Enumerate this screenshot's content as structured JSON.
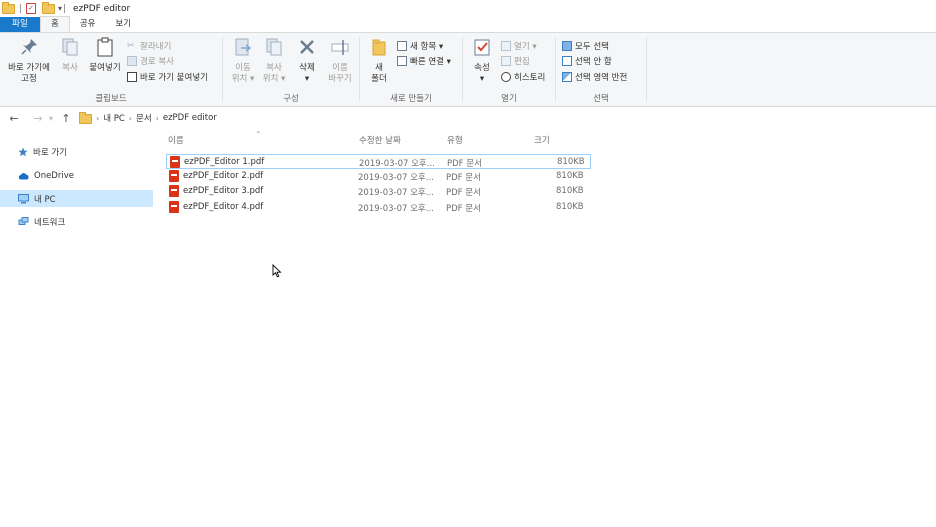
{
  "window": {
    "title": "ezPDF editor"
  },
  "tabs": {
    "file": "파일",
    "home": "홈",
    "share": "공유",
    "view": "보기"
  },
  "ribbon": {
    "clipboard": {
      "label": "클립보드",
      "pin": [
        "바로 가기에",
        "고정"
      ],
      "copy": "복사",
      "paste": "붙여넣기",
      "cut": "잘라내기",
      "copy_path": "경로 복사",
      "paste_shortcut": "바로 가기 붙여넣기"
    },
    "organize": {
      "label": "구성",
      "move_to": [
        "이동",
        "위치 ▾"
      ],
      "copy_to": [
        "복사",
        "위치 ▾"
      ],
      "delete": [
        "삭제",
        "▾"
      ],
      "rename": [
        "이름",
        "바꾸기"
      ]
    },
    "new": {
      "label": "새로 만들기",
      "new_folder": [
        "새",
        "폴더"
      ],
      "new_item": "새 항목 ▾",
      "easy_access": "빠른 연결 ▾"
    },
    "open": {
      "label": "열기",
      "properties": [
        "속성",
        "▾"
      ],
      "open": "열기 ▾",
      "edit": "편집",
      "history": "히스토리"
    },
    "select": {
      "label": "선택",
      "select_all": "모두 선택",
      "select_none": "선택 안 함",
      "invert": "선택 영역 반전"
    }
  },
  "address": {
    "crumbs": [
      "내 PC",
      "문서",
      "ezPDF editor"
    ]
  },
  "nav": {
    "items": [
      {
        "label": "바로 가기",
        "icon": "star-icon"
      },
      {
        "label": "OneDrive",
        "icon": "cloud-icon"
      },
      {
        "label": "내 PC",
        "icon": "computer-icon"
      },
      {
        "label": "네트워크",
        "icon": "network-icon"
      }
    ]
  },
  "columns": {
    "name": "이름",
    "date": "수정한 날짜",
    "type": "유형",
    "size": "크기"
  },
  "files": [
    {
      "name": "ezPDF_Editor 1.pdf",
      "date": "2019-03-07 오후...",
      "type": "PDF 문서",
      "size": "810KB"
    },
    {
      "name": "ezPDF_Editor 2.pdf",
      "date": "2019-03-07 오후...",
      "type": "PDF 문서",
      "size": "810KB"
    },
    {
      "name": "ezPDF_Editor 3.pdf",
      "date": "2019-03-07 오후...",
      "type": "PDF 문서",
      "size": "810KB"
    },
    {
      "name": "ezPDF_Editor 4.pdf",
      "date": "2019-03-07 오후...",
      "type": "PDF 문서",
      "size": "810KB"
    }
  ],
  "colors": {
    "file_tab": "#1979ca",
    "selection": "#cce8ff",
    "pdf_icon": "#d9331a",
    "folder": "#f1c65a"
  }
}
